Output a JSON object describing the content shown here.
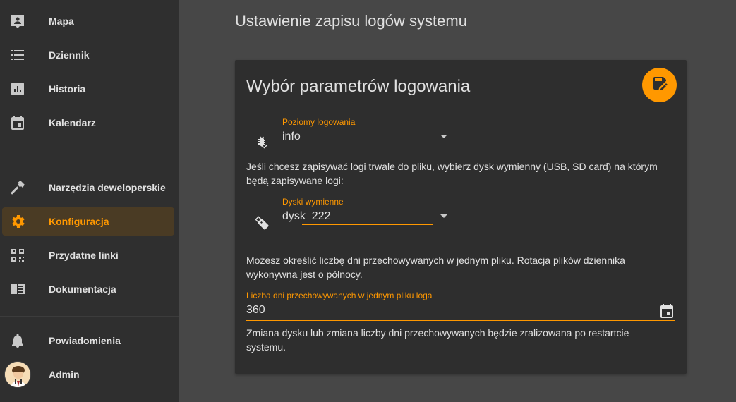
{
  "sidebar": {
    "items": [
      {
        "label": "Mapa",
        "icon": "map-account-icon"
      },
      {
        "label": "Dziennik",
        "icon": "list-icon"
      },
      {
        "label": "Historia",
        "icon": "chart-box-icon"
      },
      {
        "label": "Kalendarz",
        "icon": "calendar-icon"
      },
      {
        "label": "Narzędzia deweloperskie",
        "icon": "hammer-icon"
      },
      {
        "label": "Konfiguracja",
        "icon": "gear-icon",
        "active": true
      },
      {
        "label": "Przydatne linki",
        "icon": "qrcode-icon"
      },
      {
        "label": "Dokumentacja",
        "icon": "book-icon"
      }
    ],
    "notifications_label": "Powiadomienia",
    "user_label": "Admin"
  },
  "page": {
    "title": "Ustawienie zapisu logów systemu"
  },
  "card": {
    "title": "Wybór parametrów logowania",
    "save_icon": "content-save-edit-icon",
    "log_level": {
      "label": "Poziomy logowania",
      "value": "info",
      "icon": "bug-check-icon"
    },
    "disk_help": "Jeśli chcesz zapisywać logi trwale do pliku, wybierz dysk wymienny (USB, SD card) na którym będą zapisywane logi:",
    "disk": {
      "label": "Dyski wymienne",
      "value": "dysk_222",
      "icon": "usb-flash-drive-icon"
    },
    "days_help": "Możesz określić liczbę dni przechowywanych w jednym pliku. Rotacja plików dziennika wykonywna jest o północy.",
    "days": {
      "label": "Liczba dni przechowywanych w jednym pliku loga",
      "value": "360",
      "icon": "calendar-icon"
    },
    "restart_note": "Zmiana dysku lub zmiana liczby dni przechowywanych będzie zralizowana po restartcie systemu."
  },
  "colors": {
    "accent": "#ff9800",
    "sidebar_bg": "#2f2f2f",
    "page_bg": "#474747",
    "card_bg": "#2e2e2e",
    "text": "#e1e1e1"
  }
}
